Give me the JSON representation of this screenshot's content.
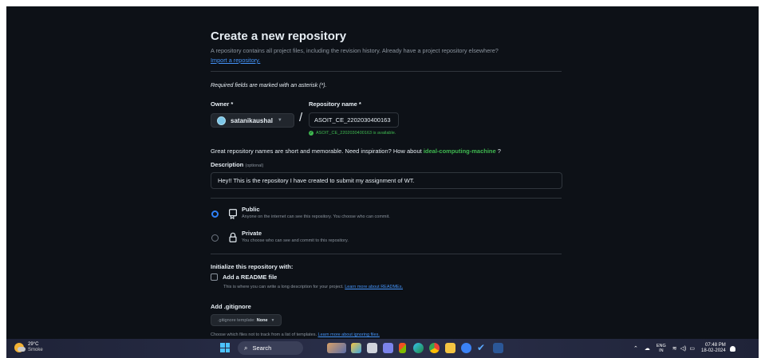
{
  "page": {
    "title": "Create a new repository",
    "intro": "A repository contains all project files, including the revision history. Already have a project repository elsewhere?",
    "import_link": "Import a repository.",
    "required_note": "Required fields are marked with an asterisk (*)."
  },
  "owner": {
    "label": "Owner *",
    "value": "satanikaushal"
  },
  "repo": {
    "label": "Repository name *",
    "value": "ASOIT_CE_2202030400163",
    "availability": "ASOIT_CE_2202030400163 is available."
  },
  "names_hint": {
    "text": "Great repository names are short and memorable. Need inspiration? How about",
    "suggestion": "ideal-computing-machine",
    "suffix": "?"
  },
  "description": {
    "label": "Description",
    "optional": "(optional)",
    "value": "Hey!! This is the repository I have created to submit my assignment of WT."
  },
  "visibility": {
    "selected": "public",
    "public_title": "Public",
    "public_desc": "Anyone on the internet can see this repository. You choose who can commit.",
    "private_title": "Private",
    "private_desc": "You choose who can see and commit to this repository."
  },
  "initialize": {
    "title": "Initialize this repository with:",
    "readme_label": "Add a README file",
    "readme_checked": false,
    "readme_desc": "This is where you can write a long description for your project.",
    "readme_link": "Learn more about READMEs."
  },
  "gitignore": {
    "title": "Add .gitignore",
    "template_label": ".gitignore template:",
    "template_value": "None",
    "desc": "Choose which files not to track from a list of templates.",
    "link": "Learn more about ignoring files."
  },
  "taskbar": {
    "temperature": "29°C",
    "weather": "Smoke",
    "search_label": "Search",
    "lang_top": "ENG",
    "lang_bottom": "IN",
    "time": "07:48 PM",
    "date": "18-02-2024"
  },
  "colors": {
    "background": "#0d1117",
    "accent_blue": "#4493f8",
    "success_green": "#3fb950"
  }
}
